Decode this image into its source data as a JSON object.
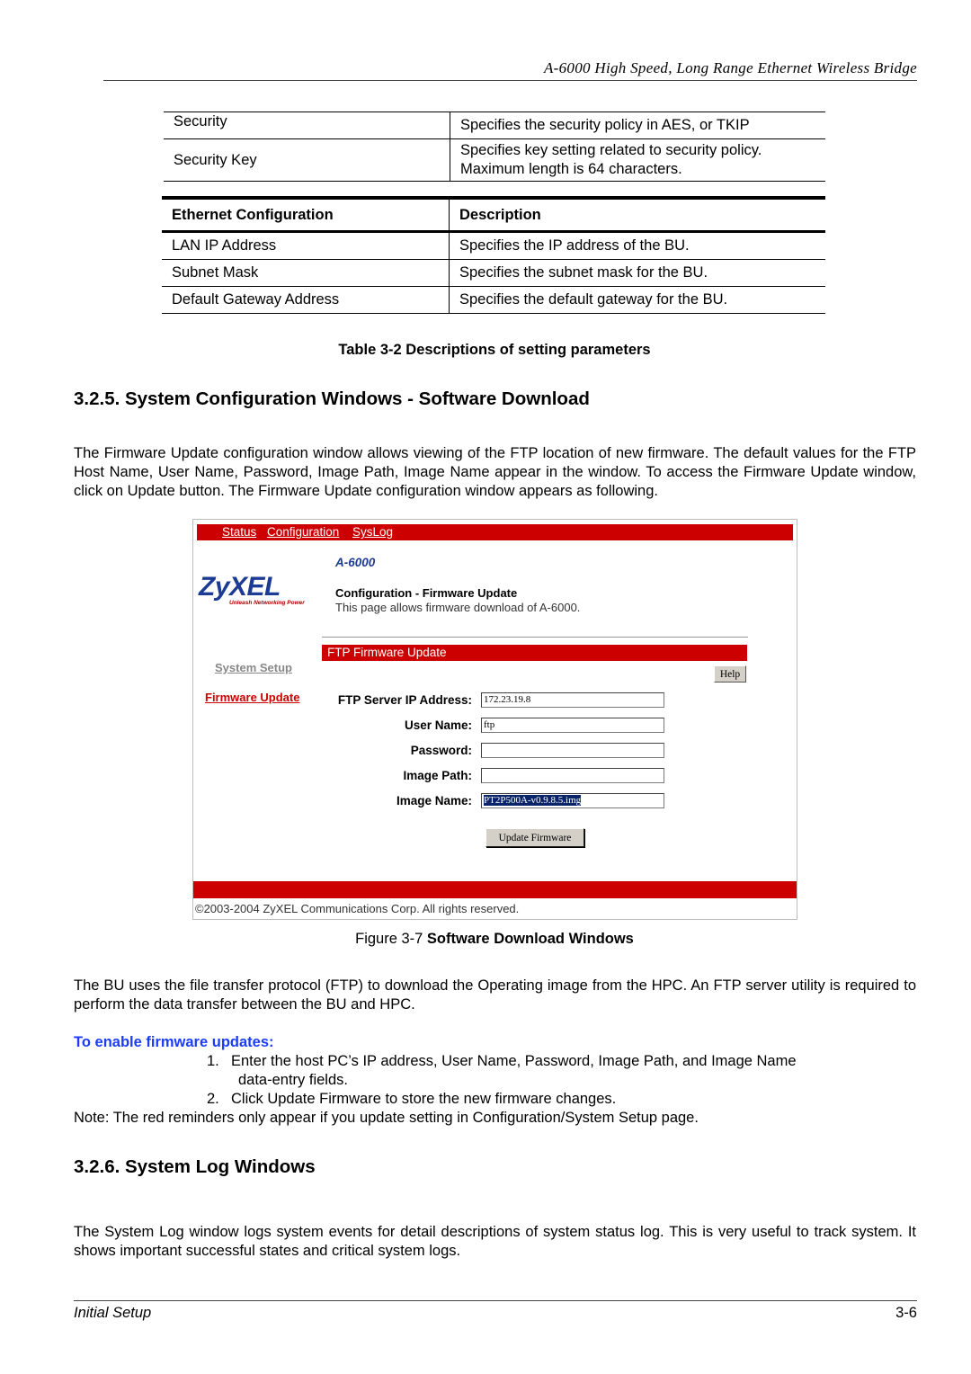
{
  "header": {
    "running_title": "A-6000 High Speed, Long Range Ethernet Wireless Bridge"
  },
  "security_table": {
    "rows": [
      {
        "name": "Security",
        "description": "Specifies the security policy in AES, or TKIP"
      },
      {
        "name": "Security Key",
        "description_lines": [
          "Specifies key setting related to security policy.",
          "Maximum length is 64 characters."
        ]
      }
    ]
  },
  "ethernet_table": {
    "headers": [
      "Ethernet Configuration",
      "Description"
    ],
    "rows": [
      {
        "name": "LAN IP Address",
        "description": "Specifies the IP address of the BU."
      },
      {
        "name": "Subnet Mask",
        "description": "Specifies the subnet mask for the BU."
      },
      {
        "name": "Default Gateway Address",
        "description": "Specifies the default gateway for the BU."
      }
    ]
  },
  "table_caption": "Table 3-2 Descriptions of setting parameters",
  "section_325": {
    "heading": "3.2.5. System Configuration Windows - Software Download",
    "intro": "The Firmware Update configuration window allows viewing of the FTP location of new firmware. The default values for the FTP Host Name, User Name, Password, Image Path, Image Name appear in the window. To access the Firmware Update window, click on Update button. The Firmware Update configuration window appears as following."
  },
  "screenshot": {
    "top_nav": [
      "Status",
      "Configuration",
      "SysLog"
    ],
    "model": "A-6000",
    "logo_text": "ZyXEL",
    "logo_tagline": "Unleash Networking Power",
    "page_title": "Configuration - Firmware Update",
    "page_subtitle": "This page allows firmware download of A-6000.",
    "section_bar": "FTP  Firmware Update",
    "side_nav": [
      "System Setup",
      "Firmware Update"
    ],
    "help_label": "Help",
    "fields": [
      {
        "label": "FTP Server IP Address:",
        "value": "172.23.19.8"
      },
      {
        "label": "User Name:",
        "value": "ftp"
      },
      {
        "label": "Password:",
        "value": ""
      },
      {
        "label": "Image Path:",
        "value": ""
      },
      {
        "label": "Image Name:",
        "value": "PT2P500A-v0.9.8.5.img"
      }
    ],
    "update_button": "Update Firmware",
    "copyright": "©2003-2004 ZyXEL Communications Corp.  All rights reserved."
  },
  "figure_caption": {
    "prefix": "Figure 3-7 ",
    "title": "Software Download Windows"
  },
  "ftp_paragraph": "The BU uses the file transfer protocol (FTP) to download the Operating image from the HPC. An FTP server utility is required to perform the data transfer between the BU and HPC.",
  "procedure": {
    "heading": "To enable firmware updates:",
    "steps": [
      {
        "num": "1.",
        "text": "Enter the host PC’s IP address, User Name, Password, Image Path, and Image Name",
        "cont": "data-entry fields."
      },
      {
        "num": "2.",
        "text": "Click Update Firmware to store the new firmware changes."
      }
    ],
    "note": "Note: The red reminders only appear if you update setting in Configuration/System Setup page."
  },
  "section_326": {
    "heading": "3.2.6. System Log Windows",
    "body": "The System Log window logs system events for detail descriptions of system status log. This is very useful to track system. It shows important successful states and critical system logs."
  },
  "footer": {
    "left": "Initial Setup",
    "right": "3-6"
  },
  "colors": {
    "brand_red": "#cc0000",
    "link_blue": "#1a3cff",
    "logo_blue": "#1c3b95"
  }
}
